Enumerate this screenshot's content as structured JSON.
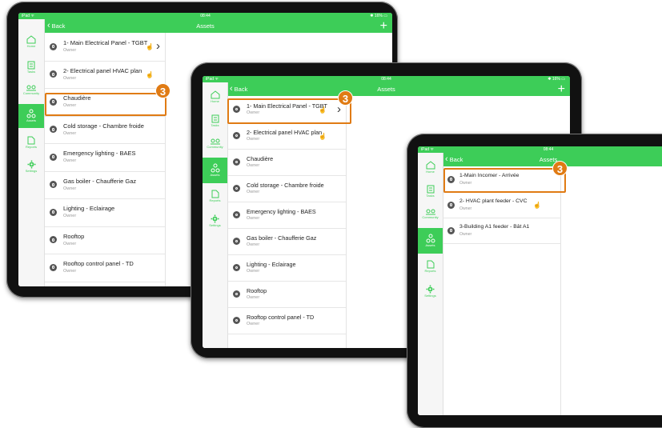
{
  "colors": {
    "brand_green": "#3dcd58",
    "callout_orange": "#e07b14"
  },
  "status": {
    "carrier": "iPad ᯤ",
    "time": "08:44",
    "battery": "✱ 16% ▭"
  },
  "nav": {
    "back_label": "Back",
    "title": "Assets",
    "add_icon": "+"
  },
  "sidebar": [
    {
      "label": "Home",
      "icon": "home-icon"
    },
    {
      "label": "Tasks",
      "icon": "tasks-icon"
    },
    {
      "label": "Community",
      "icon": "community-icon"
    },
    {
      "label": "Assets",
      "icon": "assets-icon",
      "active": true
    },
    {
      "label": "Reports",
      "icon": "reports-icon"
    },
    {
      "label": "Settings",
      "icon": "gear-icon"
    }
  ],
  "callout_number": "3",
  "tablet1": {
    "items": [
      {
        "name": "1- Main Electrical Panel - TGBT",
        "sub": "Owner"
      },
      {
        "name": "2- Electrical panel HVAC plan",
        "sub": "Owner"
      },
      {
        "name": "Chaudière",
        "sub": "Owner"
      },
      {
        "name": "Cold storage - Chambre froide",
        "sub": "Owner"
      },
      {
        "name": "Emergency lighting - BAES",
        "sub": "Owner"
      },
      {
        "name": "Gas boiler - Chaufferie Gaz",
        "sub": "Owner"
      },
      {
        "name": "Lighting - Eclairage",
        "sub": "Owner"
      },
      {
        "name": "Rooftop",
        "sub": "Owner"
      },
      {
        "name": "Rooftop control panel - TD",
        "sub": "Owner"
      }
    ]
  },
  "tablet2": {
    "items": [
      {
        "name": "1- Main Electrical Panel - TGBT",
        "sub": "Owner"
      },
      {
        "name": "2- Electrical panel HVAC plan",
        "sub": "Owner"
      },
      {
        "name": "Chaudière",
        "sub": "Owner"
      },
      {
        "name": "Cold storage - Chambre froide",
        "sub": "Owner"
      },
      {
        "name": "Emergency lighting - BAES",
        "sub": "Owner"
      },
      {
        "name": "Gas boiler - Chaufferie Gaz",
        "sub": "Owner"
      },
      {
        "name": "Lighting - Eclairage",
        "sub": "Owner"
      },
      {
        "name": "Rooftop",
        "sub": "Owner"
      },
      {
        "name": "Rooftop control panel - TD",
        "sub": "Owner"
      }
    ]
  },
  "tablet3": {
    "items": [
      {
        "name": "1-Main Incomer - Arrivée",
        "sub": "Owner"
      },
      {
        "name": "2- HVAC plant feeder - CVC",
        "sub": "Owner"
      },
      {
        "name": "3-Building A1 feeder - Bât A1",
        "sub": "Owner"
      }
    ]
  }
}
